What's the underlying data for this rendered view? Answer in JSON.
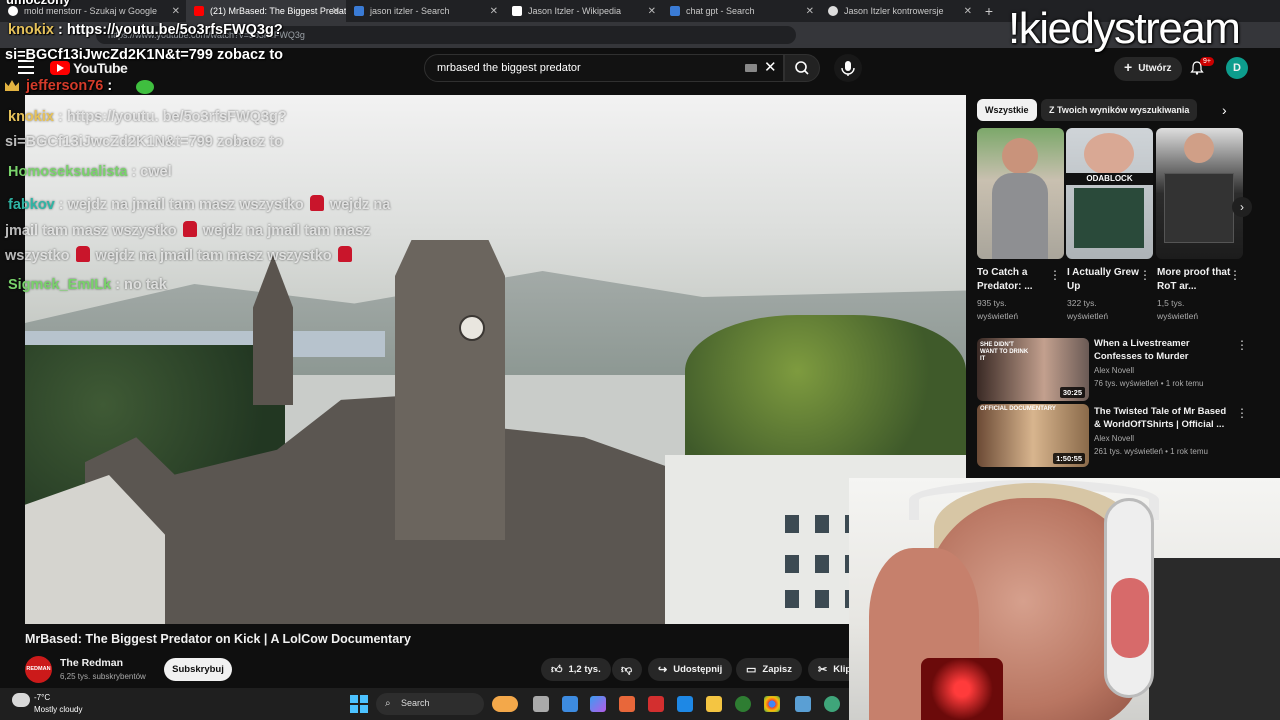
{
  "browser": {
    "tabs": [
      {
        "label": "mold menstorr - Szukaj w Google",
        "active": false
      },
      {
        "label": "(21) MrBased: The Biggest Predat",
        "active": true
      },
      {
        "label": "jason itzler - Search",
        "active": false
      },
      {
        "label": "Jason Itzler - Wikipedia",
        "active": false
      },
      {
        "label": "chat gpt - Search",
        "active": false
      },
      {
        "label": "Jason Itzler kontrowersje",
        "active": false
      }
    ],
    "new_tab": "+",
    "url": "https://www.youtube.com/watch?v=5o3rfsFWQ3g"
  },
  "youtube": {
    "logo_text": "YouTube",
    "search_value": "mrbased the biggest predator",
    "create_label": "Utwórz",
    "notif_count": "9+",
    "avatar_letter": "D"
  },
  "video": {
    "title": "MrBased: The Biggest Predator on Kick | A LolCow Documentary",
    "channel": {
      "name": "The Redman",
      "subs": "6,25 tys. subskrybentów",
      "avatar_text": "REDMAN"
    },
    "subscribe_label": "Subskrybuj",
    "likes": "1,2 tys.",
    "share_label": "Udostępnij",
    "save_label": "Zapisz",
    "clip_label": "Klip"
  },
  "chips": [
    {
      "label": "Wszystkie",
      "active": true
    },
    {
      "label": "Z Twoich wyników wyszukiwania",
      "active": false
    }
  ],
  "shorts": [
    {
      "title": "To Catch a Predator: ...",
      "views": "935 tys. wyświetleń",
      "overlay": ""
    },
    {
      "title": "I Actually Grew Up",
      "views": "322 tys. wyświetleń",
      "overlay": "ODABLOCK"
    },
    {
      "title": "More proof that RoT ar...",
      "views": "1,5 tys. wyświetleń",
      "overlay": ""
    }
  ],
  "recommendations": [
    {
      "title": "When a Livestreamer Confesses to Murder",
      "channel": "Alex Novell",
      "meta": "76 tys. wyświetleń • 1 rok temu",
      "duration": "30:25",
      "thumb_text": "SHE DIDN'T WANT TO DRINK IT"
    },
    {
      "title": "The Twisted Tale of Mr Based & WorldOfTShirts | Official ...",
      "channel": "Alex Novell",
      "meta": "261 tys. wyświetleń • 1 rok temu",
      "duration": "1:50:55",
      "thumb_text": "OFFICIAL DOCUMENTARY"
    }
  ],
  "chat": {
    "top_fragment": "umoczony",
    "lines_top": [
      {
        "nick": "knokix",
        "text": ": https://youtu.be/5o3rfsFWQ3g?"
      },
      {
        "nick": "",
        "text": "si=BGCf13iJwcZd2K1N&t=799 zobacz to"
      },
      {
        "nick": "jefferson76",
        "text": " :"
      }
    ],
    "lines_main": [
      {
        "nick": "knokix",
        "text": ": https://youtu. be/5o3rfsFWQ3g?"
      },
      {
        "nick": "",
        "text": "si=BGCf13iJwcZd2K1N&t=799 zobacz to"
      },
      {
        "nick": "Homoseksualista",
        "text": ": cwel"
      },
      {
        "nick": "fabkov",
        "text": ": wejdz na jmail tam masz wszystko"
      },
      {
        "nick": "",
        "text": "jmail tam masz wszystko"
      },
      {
        "nick": "",
        "text": "wszystko"
      },
      {
        "nick": "Sigmek_EmILk",
        "text": ": no tak"
      }
    ],
    "fragments": {
      "wejdz_na": "wejdz na",
      "wejdz_na_jmail_tam_masz": "wejdz na jmail tam masz",
      "wejdz_na_jmail_tam_masz_wszystko": "wejdz na jmail tam masz wszystko"
    }
  },
  "stream_command": "!kiedystream",
  "taskbar": {
    "temp": "-7°C",
    "weather": "Mostly cloudy",
    "search_label": "Search"
  }
}
